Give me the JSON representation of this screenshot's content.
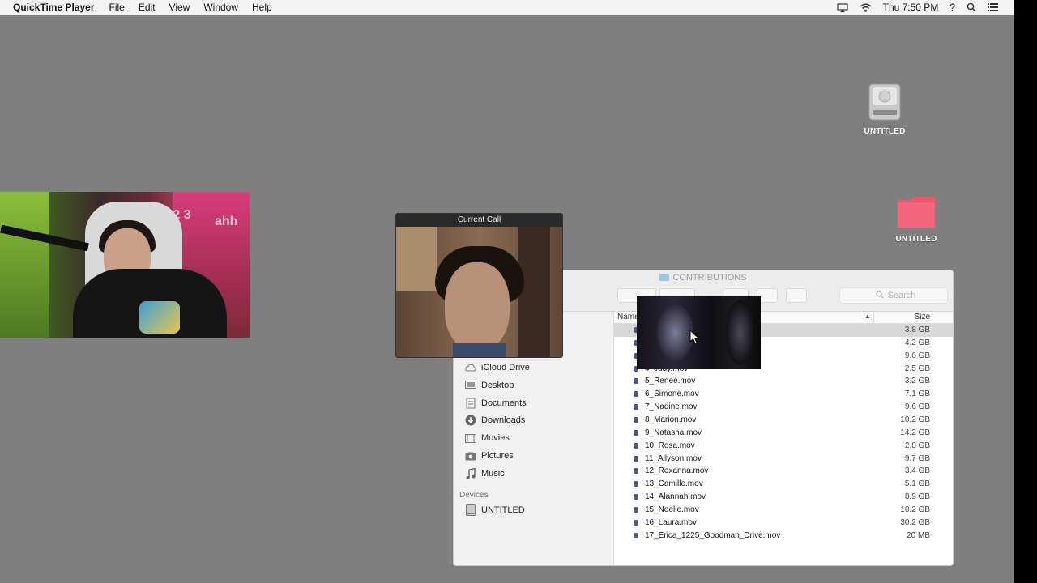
{
  "menubar": {
    "app": "QuickTime Player",
    "menus": [
      "File",
      "Edit",
      "View",
      "Window",
      "Help"
    ],
    "clock": "Thu 7:50 PM",
    "help_glyph": "?",
    "status_icons": [
      "airplay-icon",
      "wifi-icon",
      "search-icon",
      "list-icon"
    ]
  },
  "desktop": {
    "drive_label": "UNTITLED",
    "folder_label": "UNTITLED",
    "folder_color": "#f2566e"
  },
  "call": {
    "title": "Current Call"
  },
  "finder": {
    "title": "CONTRIBUTIONS",
    "search_placeholder": "Search",
    "columns": {
      "name": "Name",
      "size": "Size"
    },
    "sidebar": [
      {
        "label": "iCloud Drive",
        "icon": "cloud-icon"
      },
      {
        "label": "Desktop",
        "icon": "desktop-icon"
      },
      {
        "label": "Documents",
        "icon": "documents-icon"
      },
      {
        "label": "Downloads",
        "icon": "downloads-icon"
      },
      {
        "label": "Movies",
        "icon": "movies-icon"
      },
      {
        "label": "Pictures",
        "icon": "camera-icon"
      },
      {
        "label": "Music",
        "icon": "music-icon"
      }
    ],
    "devices_header": "Devices",
    "devices": [
      {
        "label": "UNTITLED",
        "icon": "disk-icon"
      }
    ],
    "files": [
      {
        "name": "",
        "size": "3.8 GB",
        "selected": true
      },
      {
        "name": "",
        "size": "4.2 GB"
      },
      {
        "name": "",
        "size": "9.6 GB"
      },
      {
        "name": "4_Judy.mov",
        "size": "2.5 GB"
      },
      {
        "name": "5_Renee.mov",
        "size": "3.2 GB"
      },
      {
        "name": "6_Simone.mov",
        "size": "7.1 GB"
      },
      {
        "name": "7_Nadine.mov",
        "size": "9.6 GB"
      },
      {
        "name": "8_Marion.mov",
        "size": "10.2 GB"
      },
      {
        "name": "9_Natasha.mov",
        "size": "14.2 GB"
      },
      {
        "name": "10_Rosa.mov",
        "size": "2.8 GB"
      },
      {
        "name": "11_Allyson.mov",
        "size": "9.7 GB"
      },
      {
        "name": "12_Roxanna.mov",
        "size": "3.4 GB"
      },
      {
        "name": "13_Camille.mov",
        "size": "5.1 GB"
      },
      {
        "name": "14_Alannah.mov",
        "size": "8.9 GB"
      },
      {
        "name": "15_Noelle.mov",
        "size": "10.2 GB"
      },
      {
        "name": "16_Laura.mov",
        "size": "30.2 GB"
      },
      {
        "name": "17_Erica_1225_Goodman_Drive.mov",
        "size": "20 MB"
      }
    ]
  }
}
